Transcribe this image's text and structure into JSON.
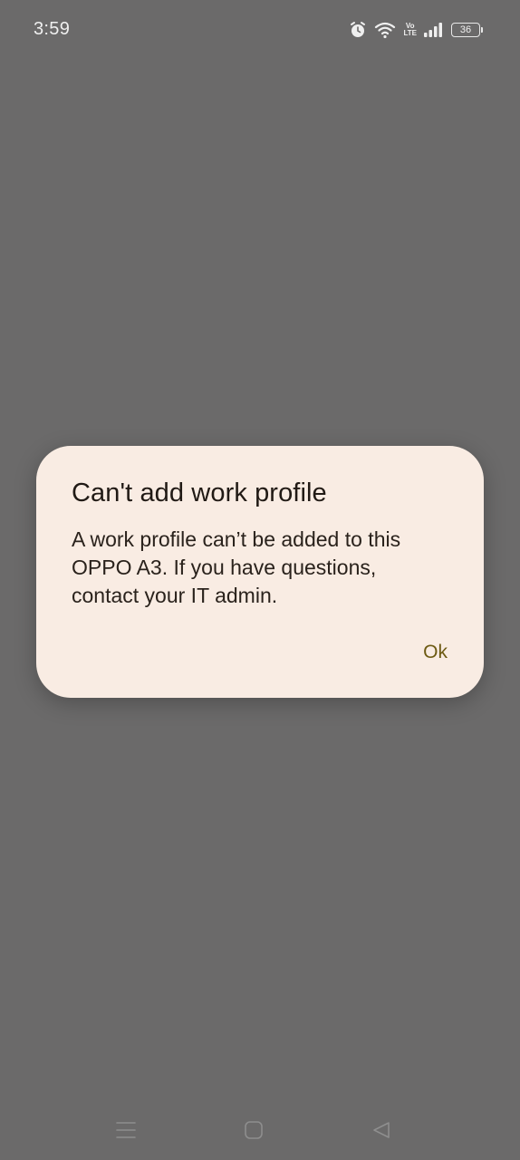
{
  "status_bar": {
    "time": "3:59",
    "network_label_top": "Vo",
    "network_label_bottom": "LTE",
    "battery_level": "36",
    "icons": [
      "alarm-icon",
      "wifi-icon",
      "volte-icon",
      "signal-icon",
      "battery-icon"
    ]
  },
  "dialog": {
    "title": "Can't add work profile",
    "message_lines": [
      "A work profile can’t be added to this",
      "OPPO A3. If you have questions,",
      "contact your IT admin."
    ],
    "ok_label": "Ok"
  },
  "colors": {
    "scrim": "#6b6a6a",
    "dialog_background": "#f9ece3",
    "button_text": "#6d5a12",
    "title_text": "#211a15"
  },
  "nav_bar": {
    "icons": [
      "recents-icon",
      "home-icon",
      "back-icon"
    ]
  }
}
